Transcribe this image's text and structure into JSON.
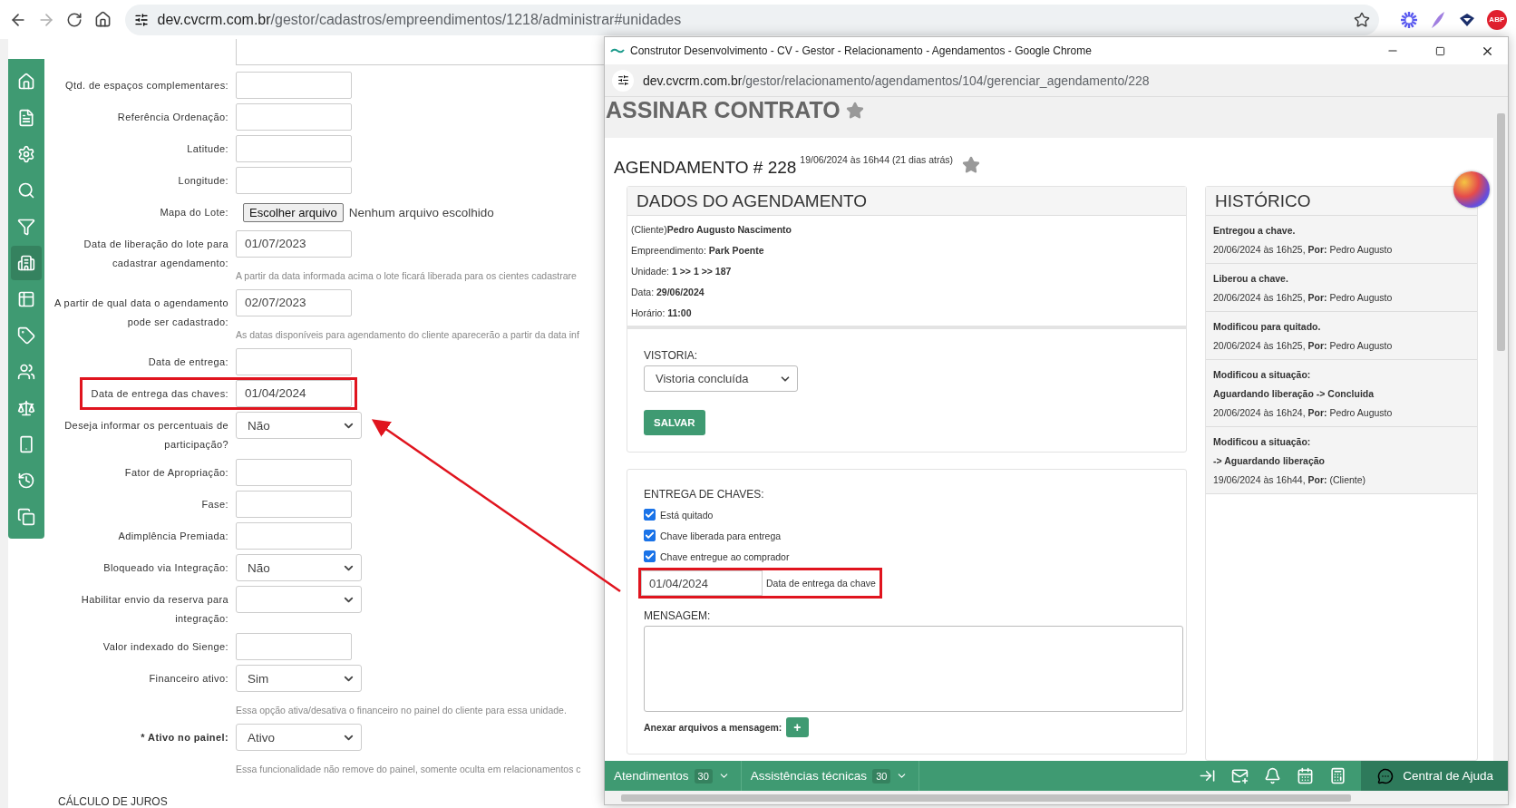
{
  "browser": {
    "url_host": "dev.cvcrm.com.br",
    "url_path": "/gestor/cadastros/empreendimentos/1218/administrar#unidades",
    "extensions": [
      {
        "kind": "burst"
      },
      {
        "kind": "feather"
      },
      {
        "kind": "emblem"
      },
      {
        "kind": "badge",
        "label": "ABP"
      }
    ]
  },
  "sidebar": {
    "items": [
      {
        "selected": false
      },
      {
        "selected": false
      },
      {
        "selected": false
      },
      {
        "selected": false
      },
      {
        "selected": false
      },
      {
        "selected": true
      },
      {
        "selected": false
      },
      {
        "selected": false
      },
      {
        "selected": false
      },
      {
        "selected": false
      },
      {
        "selected": false
      },
      {
        "selected": false
      },
      {
        "selected": false
      }
    ]
  },
  "form": {
    "fields": [
      {
        "kind": "textarea"
      },
      {
        "kind": "text",
        "label": "Qtd. de espaços complementares:"
      },
      {
        "kind": "text",
        "label": "Referência Ordenação:"
      },
      {
        "kind": "text",
        "label": "Latitude:"
      },
      {
        "kind": "text",
        "label": "Longitude:"
      },
      {
        "kind": "file",
        "label": "Mapa do Lote:",
        "button": "Escolher arquivo",
        "value": "Nenhum arquivo escolhido"
      },
      {
        "kind": "text",
        "label": "Data de liberação do lote para cadastrar agendamento:",
        "value": "01/07/2023",
        "hint": "A partir da data informada acima o lote ficará liberada para os cientes cadastrare"
      },
      {
        "kind": "text",
        "label": "A partir de qual data o agendamento pode ser cadastrado:",
        "value": "02/07/2023",
        "hint": "As datas disponíveis para agendamento do cliente aparecerão a partir da data inf"
      },
      {
        "kind": "text",
        "label": "Data de entrega:"
      },
      {
        "kind": "text",
        "label": "Data de entrega das chaves:",
        "value": "01/04/2024",
        "highlighted": true
      },
      {
        "kind": "select",
        "label": "Deseja informar os percentuais de participação?",
        "value": "Não"
      },
      {
        "kind": "text",
        "label": "Fator de Apropriação:"
      },
      {
        "kind": "text",
        "label": "Fase:"
      },
      {
        "kind": "text",
        "label": "Adimplência Premiada:"
      },
      {
        "kind": "select",
        "label": "Bloqueado via Integração:",
        "value": "Não"
      },
      {
        "kind": "select",
        "label": "Habilitar envio da reserva para integração:"
      },
      {
        "kind": "text",
        "label": "Valor indexado do Sienge:"
      },
      {
        "kind": "select",
        "label": "Financeiro ativo:",
        "value": "Sim",
        "hint": "Essa opção ativa/desativa o financeiro no painel do cliente para essa unidade."
      },
      {
        "kind": "select",
        "label": "* Ativo no painel:",
        "value": "Ativo",
        "required": true,
        "hint": "Essa funcionalidade não remove do painel, somente oculta em relacionamentos c"
      }
    ],
    "section_heading": "CÁLCULO DE JUROS"
  },
  "popup": {
    "window_title": "Construtor Desenvolvimento - CV - Gestor - Relacionamento - Agendamentos - Google Chrome",
    "url_host": "dev.cvcrm.com.br",
    "url_path": "/gestor/relacionamento/agendamentos/104/gerenciar_agendamento/228",
    "page_title": "ASSINAR CONTRATO",
    "agendamento": {
      "title": "AGENDAMENTO # 228",
      "meta": "19/06/2024 às 16h44 (21 dias atrás)"
    },
    "details": {
      "title": "DADOS DO AGENDAMENTO",
      "lines": [
        "(Cliente)**Pedro Augusto Nascimento**",
        "Empreendimento: **Park Poente**",
        "Unidade: **1 >> 1 >> 187**",
        "Data: **29/06/2024**",
        "Horário: **11:00**"
      ]
    },
    "vistoria": {
      "label": "VISTORIA:",
      "value": "Vistoria concluída",
      "button": "SALVAR"
    },
    "keys": {
      "title": "ENTREGA DE CHAVES:",
      "checks": [
        {
          "label": "Está quitado",
          "checked": true
        },
        {
          "label": "Chave liberada para entrega",
          "checked": true
        },
        {
          "label": "Chave entregue ao comprador",
          "checked": true
        }
      ],
      "date": {
        "value": "01/04/2024",
        "label": "Data de entrega da chave",
        "highlighted": true
      }
    },
    "message": {
      "label": "MENSAGEM:",
      "attach_label": "Anexar arquivos a mensagem:",
      "attach_button": "+"
    },
    "history": {
      "title": "HISTÓRICO",
      "items": [
        {
          "lines": [
            "Entregou a chave."
          ],
          "meta": "20/06/2024 às 16h25, **Por:** Pedro Augusto"
        },
        {
          "lines": [
            "Liberou a chave."
          ],
          "meta": "20/06/2024 às 16h25, **Por:** Pedro Augusto"
        },
        {
          "lines": [
            "Modificou para quitado."
          ],
          "meta": "20/06/2024 às 16h25, **Por:** Pedro Augusto"
        },
        {
          "lines": [
            "Modificou a situação:",
            "Aguardando liberação -> Concluida"
          ],
          "meta": "20/06/2024 às 16h24, **Por:** Pedro Augusto"
        },
        {
          "lines": [
            "Modificou a situação:",
            "-> Aguardando liberação"
          ],
          "meta": "19/06/2024 às 16h44, **Por:** (Cliente)"
        }
      ]
    },
    "bottom_bar": {
      "tabs": [
        {
          "label": "Atendimentos",
          "count": "30"
        },
        {
          "label": "Assistências técnicas",
          "count": "30"
        }
      ],
      "help": "Central de Ajuda"
    }
  }
}
